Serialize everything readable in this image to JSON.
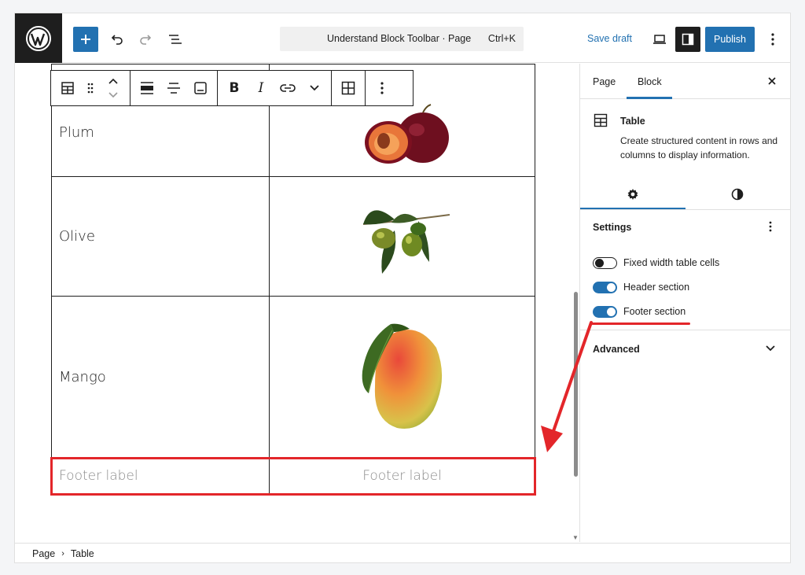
{
  "topbar": {
    "command_title": "Understand Block Toolbar · Page",
    "command_shortcut": "Ctrl+K",
    "save_draft": "Save draft",
    "publish": "Publish",
    "icons": [
      "wordpress-logo",
      "plus-icon",
      "undo-icon",
      "redo-icon",
      "list-view-icon",
      "desktop-view-icon",
      "sidebar-toggle-icon",
      "more-vertical-icon"
    ]
  },
  "block_toolbar": {
    "icons": [
      "table-icon",
      "drag-handle-icon",
      "move-up-down-icon",
      "align-wide-icon",
      "align-center-icon",
      "caption-icon",
      "bold-icon",
      "italic-icon",
      "link-icon",
      "chevron-down-icon",
      "edit-table-icon",
      "more-vertical-icon"
    ],
    "bold": "B",
    "italic": "I"
  },
  "table": {
    "rows": [
      {
        "label": "Plum",
        "image": "plum"
      },
      {
        "label": "Olive",
        "image": "olive"
      },
      {
        "label": "Mango",
        "image": "mango"
      }
    ],
    "footer": [
      "Footer label",
      "Footer label"
    ]
  },
  "sidebar": {
    "tabs": [
      "Page",
      "Block"
    ],
    "active_tab": "Block",
    "block_title": "Table",
    "block_description": "Create structured content in rows and columns to display information.",
    "settings_title": "Settings",
    "toggles": [
      {
        "label": "Fixed width table cells",
        "on": false
      },
      {
        "label": "Header section",
        "on": true
      },
      {
        "label": "Footer section",
        "on": true
      }
    ],
    "advanced_title": "Advanced"
  },
  "breadcrumb": [
    "Page",
    "Table"
  ],
  "colors": {
    "accent": "#2271b1",
    "highlight": "#e3262a",
    "dark": "#1e1e1e"
  }
}
